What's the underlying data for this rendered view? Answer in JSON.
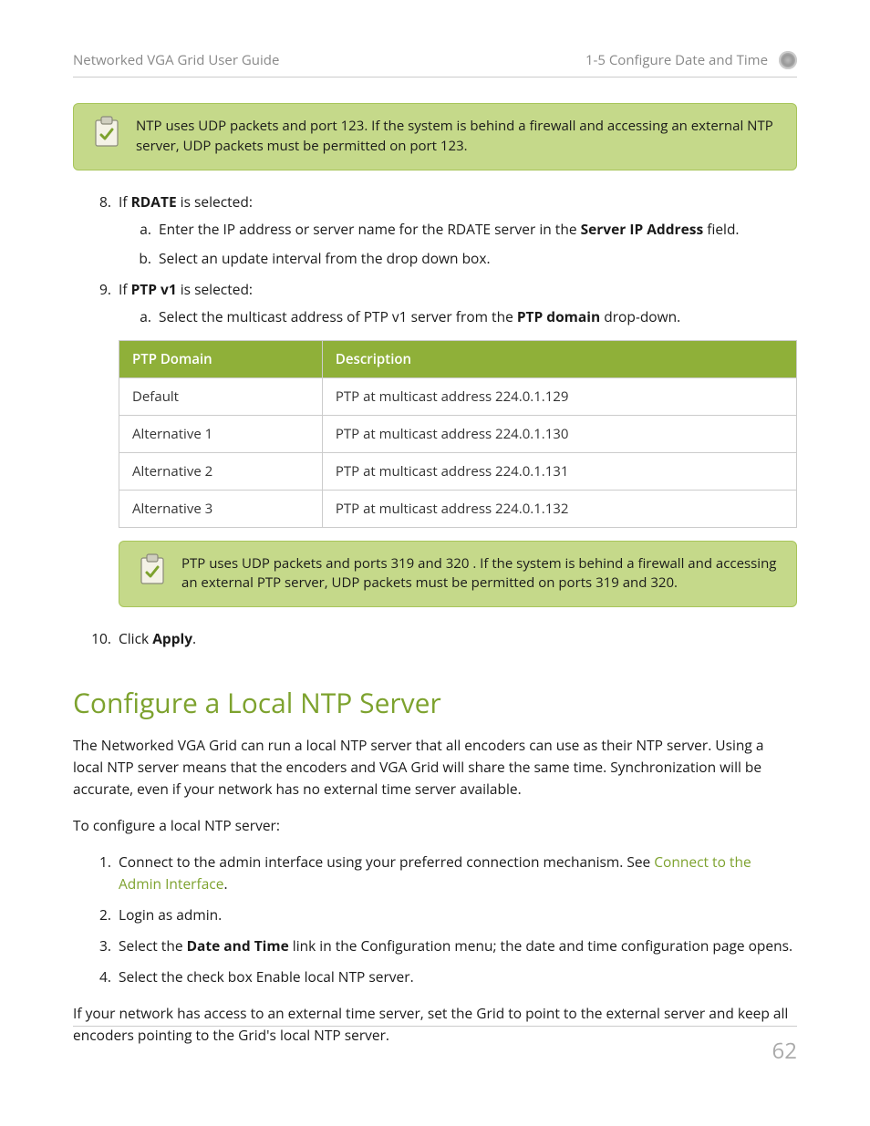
{
  "header": {
    "left": "Networked VGA Grid User Guide",
    "right": "1-5 Configure Date and Time"
  },
  "callout_ntp": "NTP uses UDP packets and port 123. If the system is behind a firewall and accessing an external NTP server, UDP packets must be permitted on port 123.",
  "step8": {
    "prefix": "If ",
    "bold": "RDATE",
    "suffix": " is selected:",
    "a_prefix": "Enter the IP address or server name for the RDATE server in the ",
    "a_bold": "Server IP Address",
    "a_suffix": " field.",
    "b": "Select an update interval from the drop down box."
  },
  "step9": {
    "prefix": "If ",
    "bold": "PTP v1",
    "suffix": " is selected:",
    "a_prefix": "Select the multicast address of PTP v1 server from the ",
    "a_bold": "PTP domain",
    "a_suffix": " drop-down."
  },
  "table": {
    "col1": "PTP Domain",
    "col2": "Description",
    "rows": [
      {
        "domain": "Default",
        "desc": "PTP at multicast address 224.0.1.129"
      },
      {
        "domain": "Alternative 1",
        "desc": "PTP at multicast address 224.0.1.130"
      },
      {
        "domain": "Alternative 2",
        "desc": "PTP at multicast address 224.0.1.131"
      },
      {
        "domain": "Alternative 3",
        "desc": "PTP at multicast address 224.0.1.132"
      }
    ]
  },
  "callout_ptp": "PTP uses UDP packets and ports 319 and 320 . If the system is behind a firewall and accessing an external PTP server, UDP packets must be permitted on ports 319 and 320.",
  "step10": {
    "prefix": "Click ",
    "bold": "Apply",
    "suffix": "."
  },
  "section_heading": "Configure a Local NTP Server",
  "intro_para": "The Networked VGA Grid can run a local NTP server that all encoders can use as their NTP server. Using a local NTP server means that the encoders and VGA Grid will share the same time. Synchronization will be accurate, even if your network has no external time server available.",
  "config_lead": "To configure a local NTP server:",
  "config": {
    "s1_prefix": "Connect to the admin interface using your preferred connection mechanism. See ",
    "s1_link": "Connect to the Admin Interface",
    "s1_suffix": ".",
    "s2": "Login as admin.",
    "s3_prefix": "Select the ",
    "s3_bold": "Date and Time",
    "s3_suffix": " link in the Configuration menu; the date and time configuration page opens.",
    "s4": "Select the check box Enable local NTP server."
  },
  "closing_para": "If your network has access to an external time server, set the Grid to point to the external server and keep all encoders pointing to the Grid's local NTP server.",
  "page_number": "62"
}
